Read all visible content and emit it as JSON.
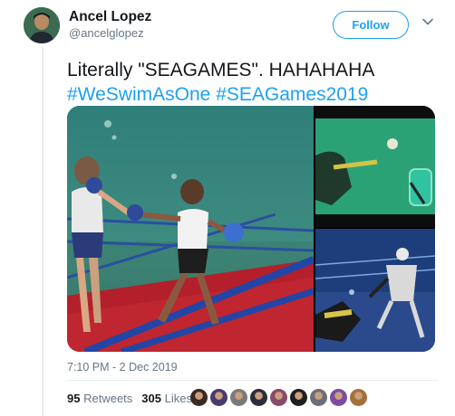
{
  "user": {
    "display_name": "Ancel Lopez",
    "handle": "@ancelglopez"
  },
  "actions": {
    "follow_label": "Follow",
    "menu_icon": "chevron-down-icon"
  },
  "tweet": {
    "text": "Literally \"SEAGAMES\". HAHAHAHA",
    "hashtags": [
      "#WeSwimAsOne",
      "#SEAGames2019"
    ],
    "timestamp": "7:10 PM - 2 Dec 2019"
  },
  "stats": {
    "retweets_count": "95",
    "retweets_label": "Retweets",
    "likes_count": "305",
    "likes_label": "Likes"
  },
  "likers": [
    {
      "color": "#3a2a22"
    },
    {
      "color": "#4a3b6b"
    },
    {
      "color": "#7a7a7a"
    },
    {
      "color": "#2c2c3a"
    },
    {
      "color": "#8a4a6a"
    },
    {
      "color": "#1f1f1f"
    },
    {
      "color": "#6b6f78"
    },
    {
      "color": "#7b4ca0"
    },
    {
      "color": "#a5703a"
    }
  ],
  "colors": {
    "brand_blue": "#1da1f2",
    "secondary_text": "#657786"
  }
}
